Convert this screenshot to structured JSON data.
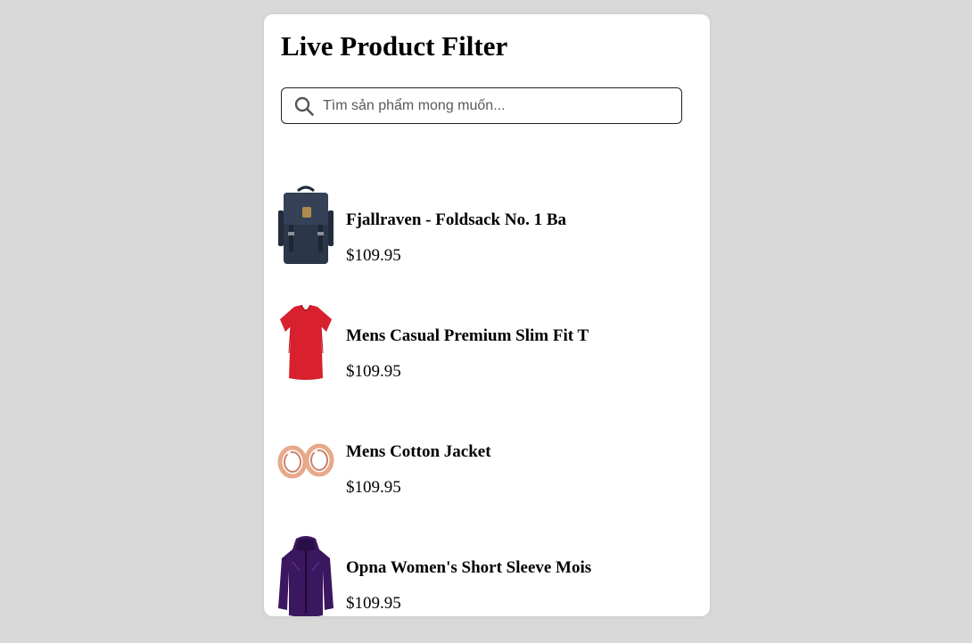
{
  "page": {
    "title": "Live Product Filter"
  },
  "search": {
    "placeholder": "Tìm sản phẩm mong muốn...",
    "value": "",
    "icon": "search-icon"
  },
  "products": [
    {
      "name": "Fjallraven - Foldsack No. 1 Ba",
      "price": "$109.95",
      "image": "backpack"
    },
    {
      "name": "Mens Casual Premium Slim Fit T",
      "price": "$109.95",
      "image": "red-tshirt"
    },
    {
      "name": "Mens Cotton Jacket",
      "price": "$109.95",
      "image": "rose-gold-rings"
    },
    {
      "name": "Opna Women's Short Sleeve Mois",
      "price": "$109.95",
      "image": "purple-jacket"
    }
  ],
  "colors": {
    "background": "#d9d9d9",
    "card": "#ffffff",
    "border": "#222222"
  }
}
